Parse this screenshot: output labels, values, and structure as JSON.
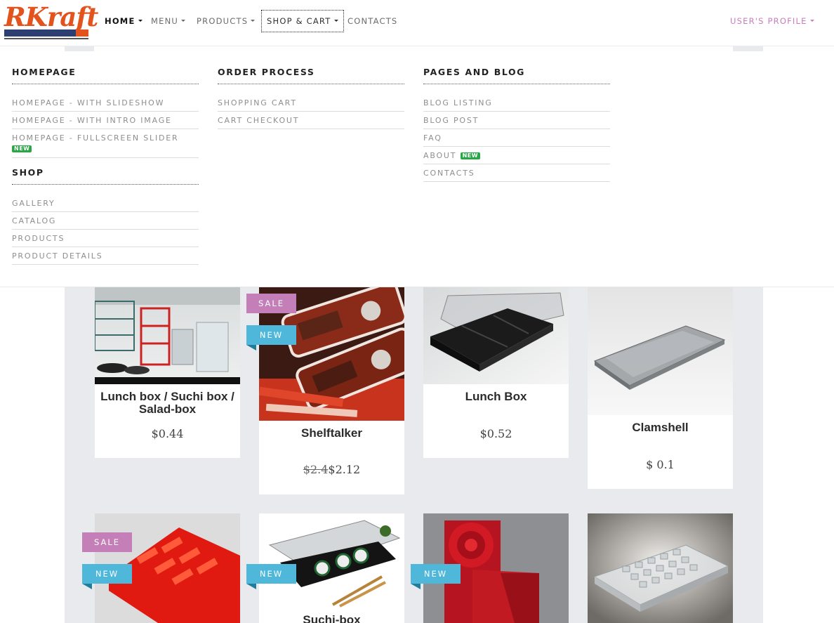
{
  "brand": {
    "logo_text": "RKraft"
  },
  "nav": {
    "home": "HOME",
    "menu": "MENU",
    "products": "PRODUCTS",
    "shop_cart": "SHOP & CART",
    "contacts": "CONTACTS",
    "profile": "USER'S PROFILE"
  },
  "megamenu": {
    "homepage": {
      "heading": "HOMEPAGE",
      "links": [
        "HOMEPAGE - WITH SLIDESHOW",
        "HOMEPAGE - WITH INTRO IMAGE",
        "HOMEPAGE - FULLSCREEN SLIDER"
      ]
    },
    "shop": {
      "heading": "SHOP",
      "links": [
        "GALLERY",
        "CATALOG",
        "PRODUCTS",
        "PRODUCT DETAILS"
      ]
    },
    "order": {
      "heading": "ORDER PROCESS",
      "links": [
        "SHOPPING CART",
        "CART CHECKOUT"
      ]
    },
    "pages": {
      "heading": "PAGES AND BLOG",
      "links": [
        "BLOG LISTING",
        "BLOG POST",
        "FAQ",
        "ABOUT",
        "CONTACTS"
      ]
    },
    "badge_new": "NEW"
  },
  "tags": {
    "sale": "SALE",
    "new": "NEW"
  },
  "products": [
    {
      "title": "Lunch box / Suchi box / Salad-box",
      "price": "$0.44"
    },
    {
      "title": "Shelftalker",
      "old_price": "$2.4",
      "price": "$2.12"
    },
    {
      "title": "Lunch Box",
      "price": "$0.52"
    },
    {
      "title": "Clamshell",
      "price": "$ 0.1"
    },
    {
      "title": "Suchi-box"
    }
  ],
  "colors": {
    "brand_orange": "#e2531d",
    "brand_navy": "#2d3e70",
    "sale_tag": "#c57fb8",
    "new_tag": "#4fb8da",
    "new_badge": "#28a745",
    "profile_link": "#c77dbd",
    "content_bg": "#e8eaed"
  }
}
